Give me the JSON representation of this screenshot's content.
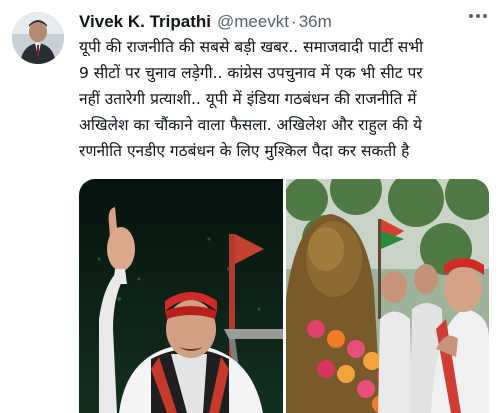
{
  "author": {
    "name": "Vivek K. Tripathi",
    "handle": "@meevkt",
    "separator": "·",
    "time": "36m"
  },
  "tweet": {
    "lines": [
      "यूपी की राजनीति की सबसे बड़ी खबर.. समाजवादी पार्टी सभी",
      "9 सीटों पर चुनाव लड़ेगी.. कांग्रेस उपचुनाव में एक भी सीट पर",
      "नहीं उतारेगी प्रत्याशी.. यूपी में इंडिया गठबंधन की राजनीति में",
      "अखिलेश का चौंकाने वाला फैसला. अखिलेश और राहुल की ये",
      "रणनीति एनडीए गठबंधन के लिए मुश्किल पैदा कर सकती है"
    ]
  },
  "icons": {
    "more": "more-options-icon"
  }
}
